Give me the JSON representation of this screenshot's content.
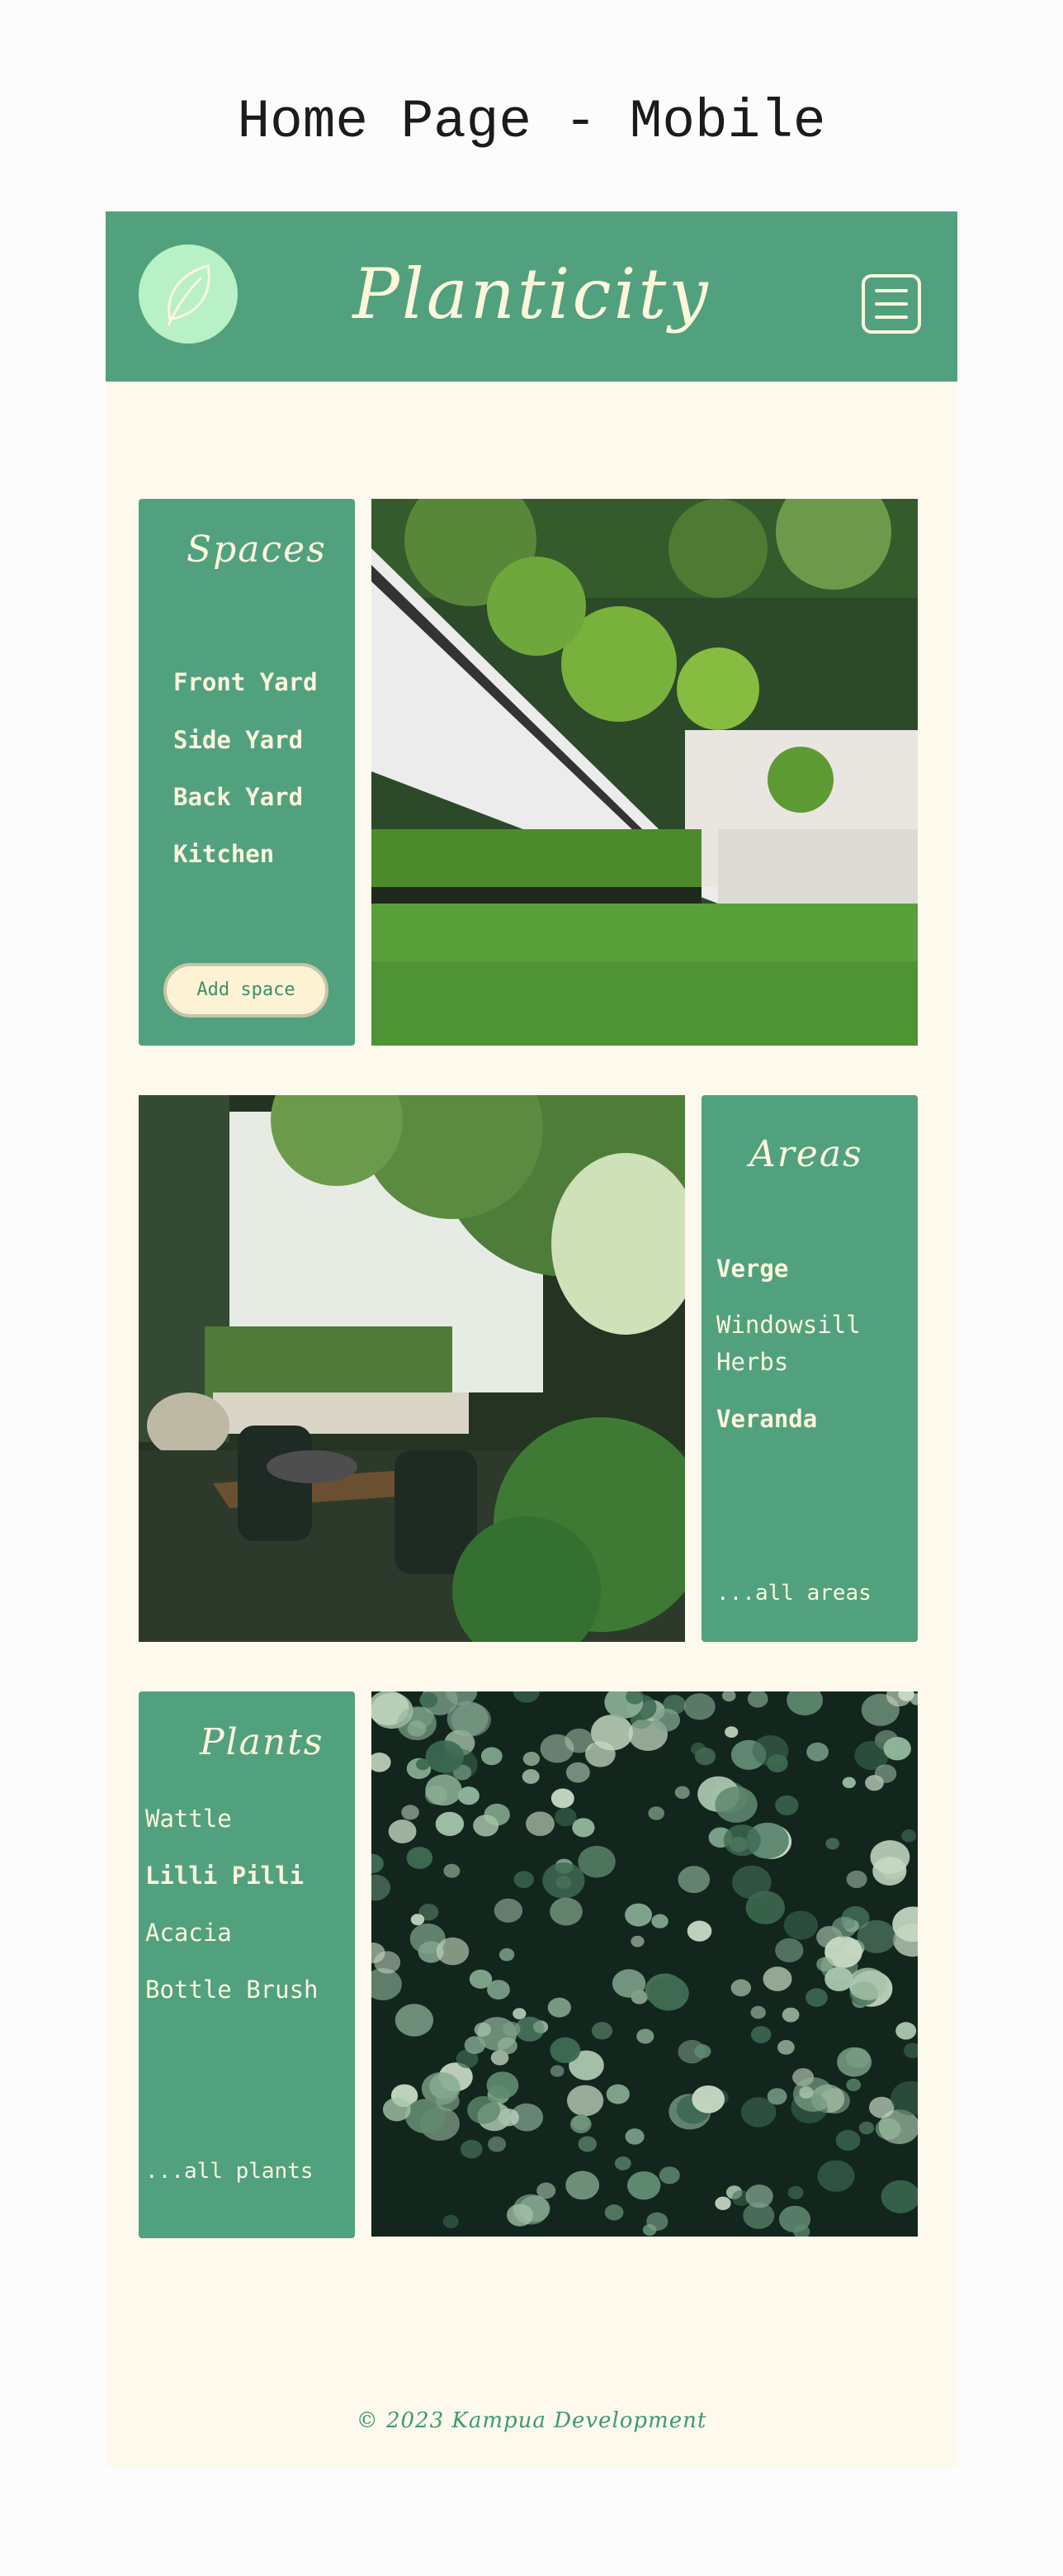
{
  "page": {
    "heading": "Home Page - Mobile"
  },
  "header": {
    "brand": "Planticity",
    "logo_icon": "leaf-icon",
    "menu_icon": "hamburger-menu-icon"
  },
  "colors": {
    "primary": "#51a17f",
    "background": "#fdf9ec",
    "cream": "#fdf6db",
    "logo_bg": "#b8f1c5"
  },
  "spaces": {
    "title": "Spaces",
    "items": [
      "Front Yard",
      "Side Yard",
      "Back Yard",
      "Kitchen"
    ],
    "button": "Add space"
  },
  "areas": {
    "title": "Areas",
    "items": [
      "Verge",
      "Windowsill Herbs",
      "Veranda"
    ],
    "more": "...all areas"
  },
  "plants": {
    "title": "Plants",
    "items": [
      "Wattle",
      "Lilli Pilli",
      "Acacia",
      "Bottle Brush"
    ],
    "more": "...all plants"
  },
  "footer": {
    "text": "© 2023 Kampua Development"
  }
}
